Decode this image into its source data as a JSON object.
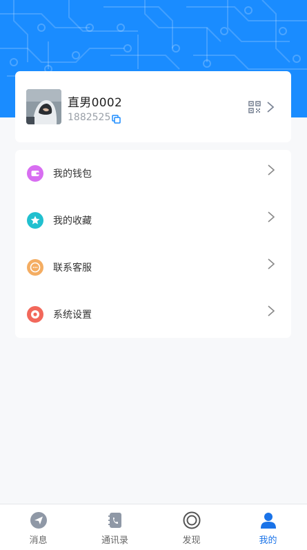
{
  "colors": {
    "header_blue": "#1a8cff",
    "active_tab": "#1a73e8",
    "wallet_icon": "#d86ef1",
    "favorites_icon": "#21c0cf",
    "service_icon": "#f4ad62",
    "settings_icon": "#f2685b"
  },
  "profile": {
    "username": "直男0002",
    "user_id": "1882525",
    "avatar_icon": "avatar-photo",
    "actions": [
      "qr-code-icon",
      "chevron-right-icon"
    ]
  },
  "menu": {
    "items": [
      {
        "label": "我的钱包",
        "icon": "wallet-icon"
      },
      {
        "label": "我的收藏",
        "icon": "star-icon"
      },
      {
        "label": "联系客服",
        "icon": "chat-icon"
      },
      {
        "label": "系统设置",
        "icon": "settings-icon"
      }
    ]
  },
  "tabbar": {
    "tabs": [
      {
        "label": "消息",
        "icon": "message-icon",
        "active": false
      },
      {
        "label": "通讯录",
        "icon": "contacts-icon",
        "active": false
      },
      {
        "label": "发现",
        "icon": "discover-icon",
        "active": false
      },
      {
        "label": "我的",
        "icon": "profile-icon",
        "active": true
      }
    ]
  }
}
